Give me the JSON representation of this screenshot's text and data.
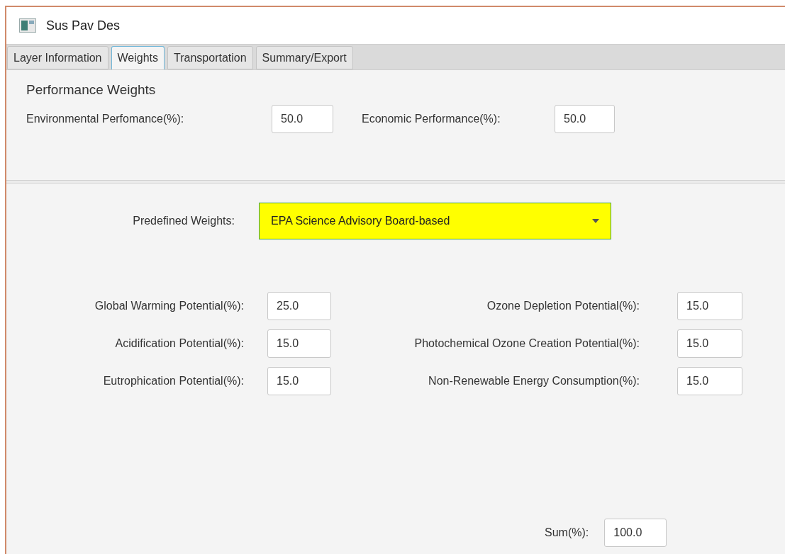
{
  "window": {
    "title": "Sus Pav Des"
  },
  "tabs": [
    {
      "label": "Layer Information",
      "selected": false
    },
    {
      "label": "Weights",
      "selected": true
    },
    {
      "label": "Transportation",
      "selected": false
    },
    {
      "label": "Summary/Export",
      "selected": false
    }
  ],
  "performance_weights": {
    "heading": "Performance Weights",
    "fields": [
      {
        "label": "Environmental Perfomance(%):",
        "value": "50.0"
      },
      {
        "label": "Economic Performance(%):",
        "value": "50.0"
      }
    ]
  },
  "predefined_weights": {
    "label": "Predefined Weights:",
    "value": "EPA Science Advisory Board-based"
  },
  "impact_weights": [
    {
      "label": "Global Warming Potential(%):",
      "value": "25.0"
    },
    {
      "label": "Ozone Depletion Potential(%):",
      "value": "15.0"
    },
    {
      "label": "Acidification Potential(%):",
      "value": "15.0"
    },
    {
      "label": "Photochemical Ozone Creation Potential(%):",
      "value": "15.0"
    },
    {
      "label": "Eutrophication Potential(%):",
      "value": "15.0"
    },
    {
      "label": "Non-Renewable Energy Consumption(%):",
      "value": "15.0"
    }
  ],
  "sum": {
    "label": "Sum(%):",
    "value": "100.0"
  }
}
